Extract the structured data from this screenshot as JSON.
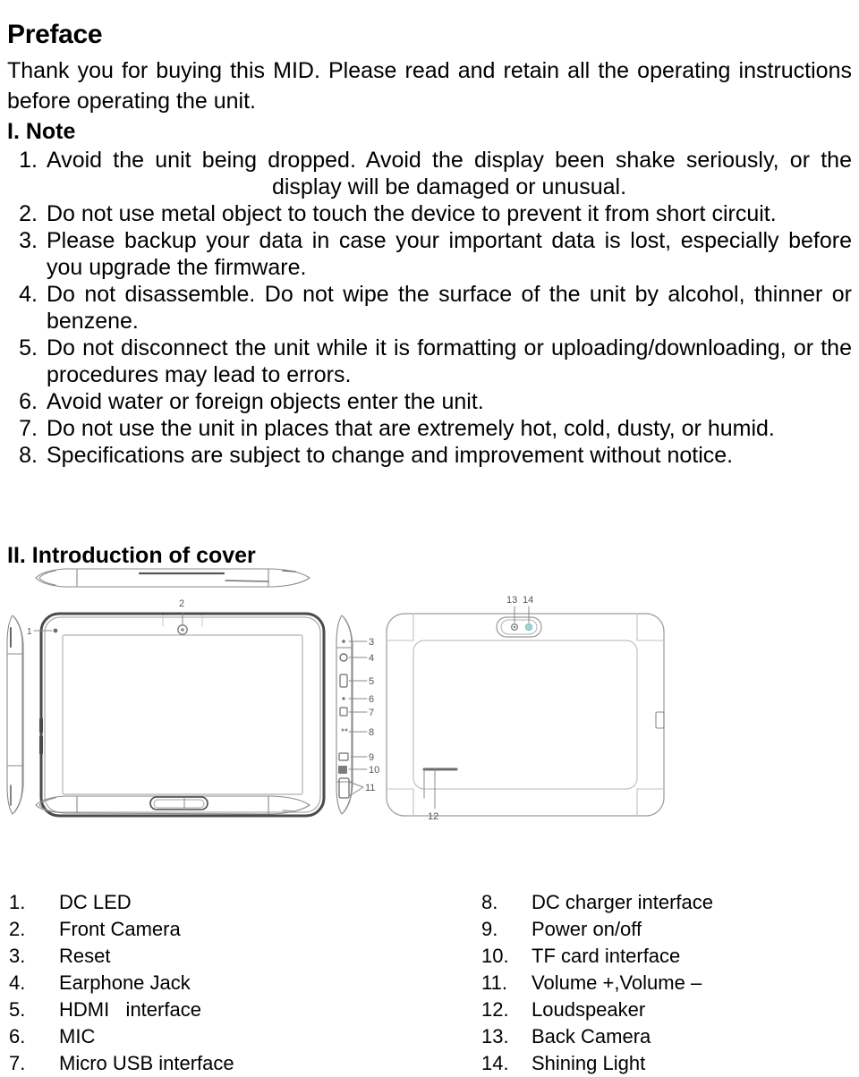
{
  "document": {
    "preface_title": "Preface",
    "intro_paragraph": "Thank you for buying this MID. Please read and retain all the operating instructions before operating the unit.",
    "note_heading": "I. Note",
    "notes": [
      {
        "num": "1.",
        "text": "Avoid the unit being dropped. Avoid the display been shake seriously, or the display will be damaged or unusual."
      },
      {
        "num": "2.",
        "text": "Do not use metal object to touch the device to prevent it from short circuit."
      },
      {
        "num": "3.",
        "text": "Please backup your data in case your important data is lost, especially before you upgrade the firmware."
      },
      {
        "num": "4.",
        "text": "Do not disassemble. Do not wipe the surface of the unit by alcohol, thinner or benzene."
      },
      {
        "num": "5.",
        "text": "Do not disconnect the unit while it is formatting or uploading/downloading, or the procedures may lead to errors."
      },
      {
        "num": "6.",
        "text": "Avoid water or foreign objects enter the unit."
      },
      {
        "num": "7.",
        "text": "Do not use the unit in places that are extremely hot, cold, dusty, or humid."
      },
      {
        "num": "8.",
        "text": "Specifications are subject to change and improvement without notice."
      }
    ],
    "section2_title": "II. Introduction of cover",
    "figure": {
      "name": "tablet-cover-diagram",
      "callouts": [
        "1",
        "2",
        "3",
        "4",
        "5",
        "6",
        "7",
        "8",
        "9",
        "10",
        "11",
        "12",
        "13",
        "14"
      ],
      "line_color": "#808080",
      "accent_color": "#9fd7d7"
    },
    "legend_left": [
      {
        "num": "1.",
        "label": "DC LED"
      },
      {
        "num": "2.",
        "label": "Front Camera"
      },
      {
        "num": "3.",
        "label": "Reset"
      },
      {
        "num": "4.",
        "label": "Earphone Jack"
      },
      {
        "num": "5.",
        "label": "HDMI   interface"
      },
      {
        "num": "6.",
        "label": "MIC"
      },
      {
        "num": "7.",
        "label": "Micro USB interface"
      }
    ],
    "legend_right": [
      {
        "num": "8.",
        "label": "DC charger interface"
      },
      {
        "num": "9.",
        "label": "Power on/off"
      },
      {
        "num": "10.",
        "label": "TF card interface"
      },
      {
        "num": "11.",
        "label": "Volume +,Volume –"
      },
      {
        "num": "12.",
        "label": "Loudspeaker"
      },
      {
        "num": "13.",
        "label": "Back Camera"
      },
      {
        "num": "14.",
        "label": "Shining Light"
      }
    ]
  }
}
